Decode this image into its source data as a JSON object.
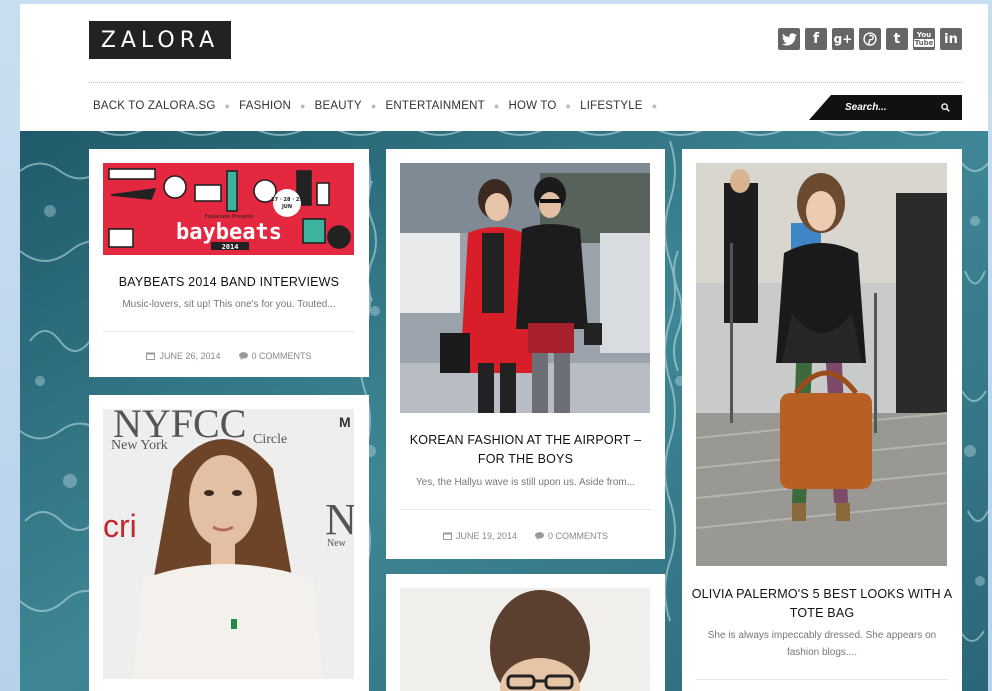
{
  "header": {
    "logo": "ZALORA",
    "social": [
      "twitter",
      "facebook",
      "google-plus",
      "pinterest",
      "tumblr",
      "youtube",
      "linkedin"
    ],
    "youtube_label_top": "You",
    "youtube_label_bottom": "Tube",
    "facebook_glyph": "f",
    "gplus_glyph": "g+",
    "tumblr_glyph": "t",
    "linkedin_glyph": "in"
  },
  "nav": {
    "items": [
      "BACK TO ZALORA.SG",
      "FASHION",
      "BEAUTY",
      "ENTERTAINMENT",
      "HOW TO",
      "LIFESTYLE"
    ]
  },
  "search": {
    "placeholder": "Search..."
  },
  "posts": [
    {
      "title": "BAYBEATS 2014 BAND INTERVIEWS",
      "excerpt": "Music-lovers, sit up! This one's for you.  Touted...",
      "date": "JUNE 26, 2014",
      "comments": "0 COMMENTS",
      "banner_small": "Esplanade Presents",
      "banner_big": "baybeats",
      "banner_year": "2014",
      "banner_dates": "27 · 28 · 29",
      "banner_month": "JUN"
    },
    {
      "title_line1": "KOREAN FASHION AT THE AIRPORT –",
      "title_line2": "FOR THE BOYS",
      "excerpt": "Yes, the Hallyu wave is still upon us. Aside from...",
      "date": "JUNE 19, 2014",
      "comments": "0 COMMENTS"
    },
    {
      "title_line1": "OLIVIA PALERMO'S 5 BEST LOOKS WITH A",
      "title_line2": "TOTE BAG",
      "excerpt_line1": "She is always impeccably dressed. She appears on",
      "excerpt_line2": "fashion blogs...."
    },
    {
      "backdrop_text_1": "NYFCC",
      "backdrop_text_2": "New York",
      "backdrop_text_3": "Circle",
      "backdrop_text_4": "cri",
      "backdrop_text_5": "N",
      "backdrop_text_6": "New",
      "backdrop_text_7": "M"
    }
  ],
  "colors": {
    "page_bg": "#c9def0",
    "banner_red": "#e3283f",
    "search_bg": "#111111",
    "icon_gray": "#666666",
    "title_text": "#111111",
    "excerpt_text": "#777777"
  }
}
